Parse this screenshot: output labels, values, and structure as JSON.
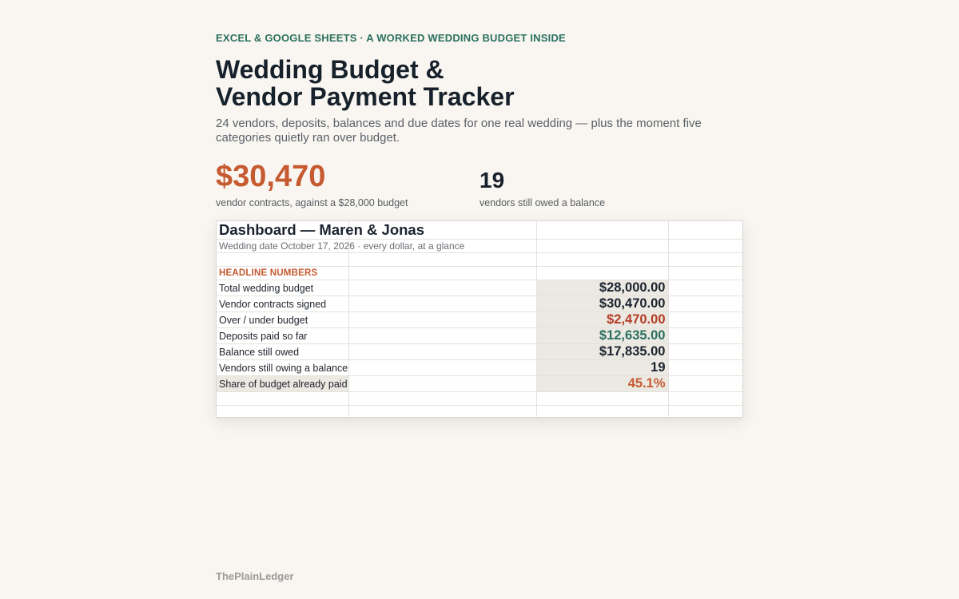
{
  "header": {
    "eyebrow": "EXCEL & GOOGLE SHEETS · A WORKED WEDDING BUDGET INSIDE",
    "title_line1": "Wedding Budget &",
    "title_line2": "Vendor Payment Tracker",
    "subtitle": "24 vendors, deposits, balances and due dates for one real wedding — plus the moment five categories quietly ran over budget."
  },
  "stats": {
    "primary_value": "$30,470",
    "primary_caption": "vendor contracts, against a $28,000 budget",
    "secondary_value": "19",
    "secondary_caption": "vendors still owed a balance"
  },
  "sheet": {
    "title": "Dashboard — Maren & Jonas",
    "subtitle": "Wedding date October 17, 2026 · every dollar, at a glance",
    "section_label": "HEADLINE NUMBERS",
    "rows": [
      {
        "label": "Total wedding budget",
        "value": "$28,000.00"
      },
      {
        "label": "Vendor contracts signed",
        "value": "$30,470.00"
      },
      {
        "label": "Over / under budget",
        "value": "$2,470.00"
      },
      {
        "label": "Deposits paid so far",
        "value": "$12,635.00"
      },
      {
        "label": "Balance still owed",
        "value": "$17,835.00"
      },
      {
        "label": "Vendors still owing a balance",
        "value": "19"
      },
      {
        "label": "Share of budget already paid",
        "value": "45.1%"
      }
    ]
  },
  "colors": {
    "accent_orange": "#c65a30",
    "accent_green": "#2a7060",
    "over_budget_red": "#b43d25"
  },
  "footer": {
    "brand": "ThePlainLedger"
  }
}
